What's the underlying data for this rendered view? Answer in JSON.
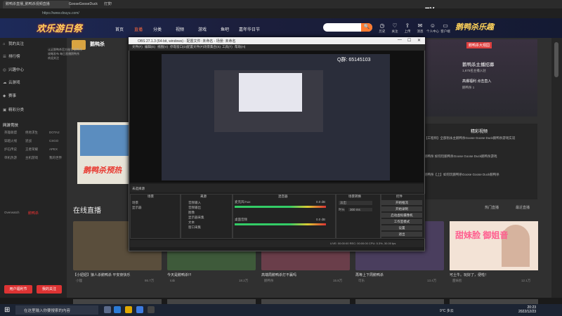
{
  "browser": {
    "tab1": "鹅鸭杀直播_鹅鸭杀视频直播",
    "tab2": "GooseGooseDuck",
    "tab3": "打赏!",
    "qq_label": "Q群:  65145103",
    "address": "https://www.douyu.com/"
  },
  "site": {
    "logo": "欢乐游日祭",
    "nav": [
      "首页",
      "直播",
      "分类",
      "视频",
      "游戏",
      "鱼吧",
      "嘉年华日节"
    ],
    "search_btn": "🔍",
    "header_icons": [
      "历史",
      "关注",
      "上传",
      "消息",
      "个人中心",
      "客户端"
    ],
    "right_logo": "鹅鸭杀乐趣"
  },
  "sidebar": {
    "items": [
      {
        "icon": "⌂",
        "label": "我的关注"
      },
      {
        "icon": "☰",
        "label": "排行榜"
      },
      {
        "icon": "◎",
        "label": "兴趣中心"
      },
      {
        "icon": "☁",
        "label": "云游戏"
      },
      {
        "icon": "◆",
        "label": "赛事"
      },
      {
        "icon": "▣",
        "label": "精彩分类"
      }
    ],
    "hot_label": "网游竞技",
    "grid_rows": [
      [
        "英雄联盟",
        "绝地求生",
        "DOTA2"
      ],
      [
        "穿越火线",
        "逆战",
        "CSGO"
      ],
      [
        "炉石传说",
        "王者荣耀",
        "APEX"
      ],
      [
        "单机热游",
        "主机游戏",
        "我的世界"
      ]
    ],
    "red_label": "鹅鸭杀",
    "overwatch": "Overwatch",
    "btn_left": "用户福利节",
    "btn_right": "我的关注"
  },
  "anchor": {
    "name": "鹅鸭杀",
    "desc": "认证鹅鸭杀官方账号 鹅鸭杀攻略发布 每日直播鹅鸭杀 欢迎关注"
  },
  "banner": {
    "text": "鹅鸭杀预热"
  },
  "live": {
    "title": "在线直播",
    "tab_a": "热门直播",
    "tab_b": "最近直播",
    "cards": [
      {
        "title": "【小妞妞】狼人杀鹅鸭杀 平安夜快乐",
        "meta": "小狸",
        "count": "86.7万"
      },
      {
        "title": "今天是鹅鸭杀!!!",
        "meta": "tobi",
        "count": "18.2万"
      },
      {
        "title": "高端局鹅鸭杀打不赢吗",
        "meta": "鹅鸭杀",
        "count": "15.8万"
      },
      {
        "title": "再等上下周鹅鸭杀",
        "meta": "可乐",
        "count": "13.4万"
      },
      {
        "title": "可土牛。玩好了，便啦！",
        "meta": "甜妹脸",
        "count": "12.1万"
      }
    ]
  },
  "right_panel": {
    "tag": "鹅鸭杀大观园",
    "name": "鹅鸭杀主播招募",
    "line1": "1,675名主播入驻",
    "line2": "高爆福利 点击直入",
    "line3": "鹅鸭杀 1",
    "video_title": "精彩视频",
    "videos": [
      "【工程师】全部别永主鹅鸭杀Goose Goose Duck鹅鸭杀游戏实况",
      "鹅鸭杀 如何玩鹅鸭杀Goose Goose Duck鹅鸭杀游戏",
      "鹅鸭杀【上】如何玩鹅鸭杀Goose Goose Duck鹅鸭杀"
    ],
    "promo": "甜妹脸 御姐音"
  },
  "obs": {
    "title": "OBS 27.1.3 (64-bit, windows) - 配置文件: 未命名 - 场景: 未命名",
    "menu": [
      "文件(F)",
      "编辑(E)",
      "视图(V)",
      "停靠窗口(D)",
      "配置文件(P)",
      "场景集合(S)",
      "工具(T)",
      "帮助(H)"
    ],
    "inner_qq": "Q群:  65145103",
    "scene_label": "未选择源",
    "panel_scenes": "场景",
    "panel_sources": "来源",
    "panel_mixer": "混音器",
    "panel_transition": "场景转换",
    "panel_controls": "控件",
    "scenes": [
      "场景",
      "显示器"
    ],
    "sources": [
      "音频输入",
      "音频输出",
      "图像",
      "显示器采集",
      "文本",
      "窗口采集"
    ],
    "mixer": [
      {
        "name": "麦克风/Aux",
        "db": "0.0 dB"
      },
      {
        "name": "桌面音频",
        "db": "0.0 dB"
      }
    ],
    "transition": "淡出",
    "duration_label": "时长",
    "duration": "300 ms",
    "controls": [
      "开始推流",
      "开始录制",
      "启动虚拟摄像机",
      "工作室模式",
      "设置",
      "退出"
    ],
    "status": "LIVE: 00:00:00   REC: 00:00:00   CPU: 5.3%, 30.00 fps"
  },
  "taskbar": {
    "start": "⊞",
    "search": "在这里输入你要搜索的内容",
    "temp": "9°C 多云",
    "time": "20:23",
    "date": "2022/12/23"
  }
}
